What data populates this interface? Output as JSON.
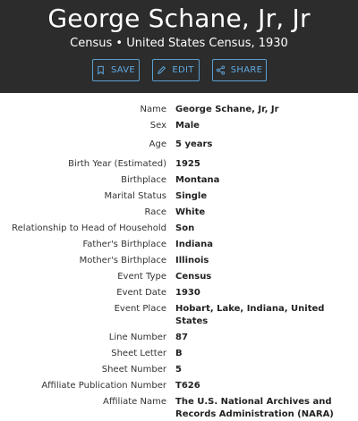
{
  "header": {
    "title": "George Schane, Jr, Jr",
    "subtitle": "Census • United States Census, 1930",
    "save_label": "SAVE",
    "edit_label": "EDIT",
    "share_label": "SHARE",
    "accent_color": "#5ea9e0",
    "background_color": "#2c2c2c"
  },
  "details": [
    {
      "label": "Name",
      "value": "George Schane, Jr, Jr"
    },
    {
      "label": "Sex",
      "value": "Male"
    },
    {
      "label": "Age",
      "value": "5 years"
    },
    {
      "label": "Birth Year (Estimated)",
      "value": "1925"
    },
    {
      "label": "Birthplace",
      "value": "Montana"
    },
    {
      "label": "Marital Status",
      "value": "Single"
    },
    {
      "label": "Race",
      "value": "White"
    },
    {
      "label": "Relationship to Head of Household",
      "value": "Son"
    },
    {
      "label": "Father's Birthplace",
      "value": "Indiana"
    },
    {
      "label": "Mother's Birthplace",
      "value": "Illinois"
    },
    {
      "label": "Event Type",
      "value": "Census"
    },
    {
      "label": "Event Date",
      "value": "1930"
    },
    {
      "label": "Event Place",
      "value": "Hobart, Lake, Indiana, United States"
    },
    {
      "label": "Line Number",
      "value": "87"
    },
    {
      "label": "Sheet Letter",
      "value": "B"
    },
    {
      "label": "Sheet Number",
      "value": "5"
    },
    {
      "label": "Affiliate Publication Number",
      "value": "T626"
    },
    {
      "label": "Affiliate Name",
      "value": "The U.S. National Archives and Records Administration (NARA)"
    }
  ]
}
